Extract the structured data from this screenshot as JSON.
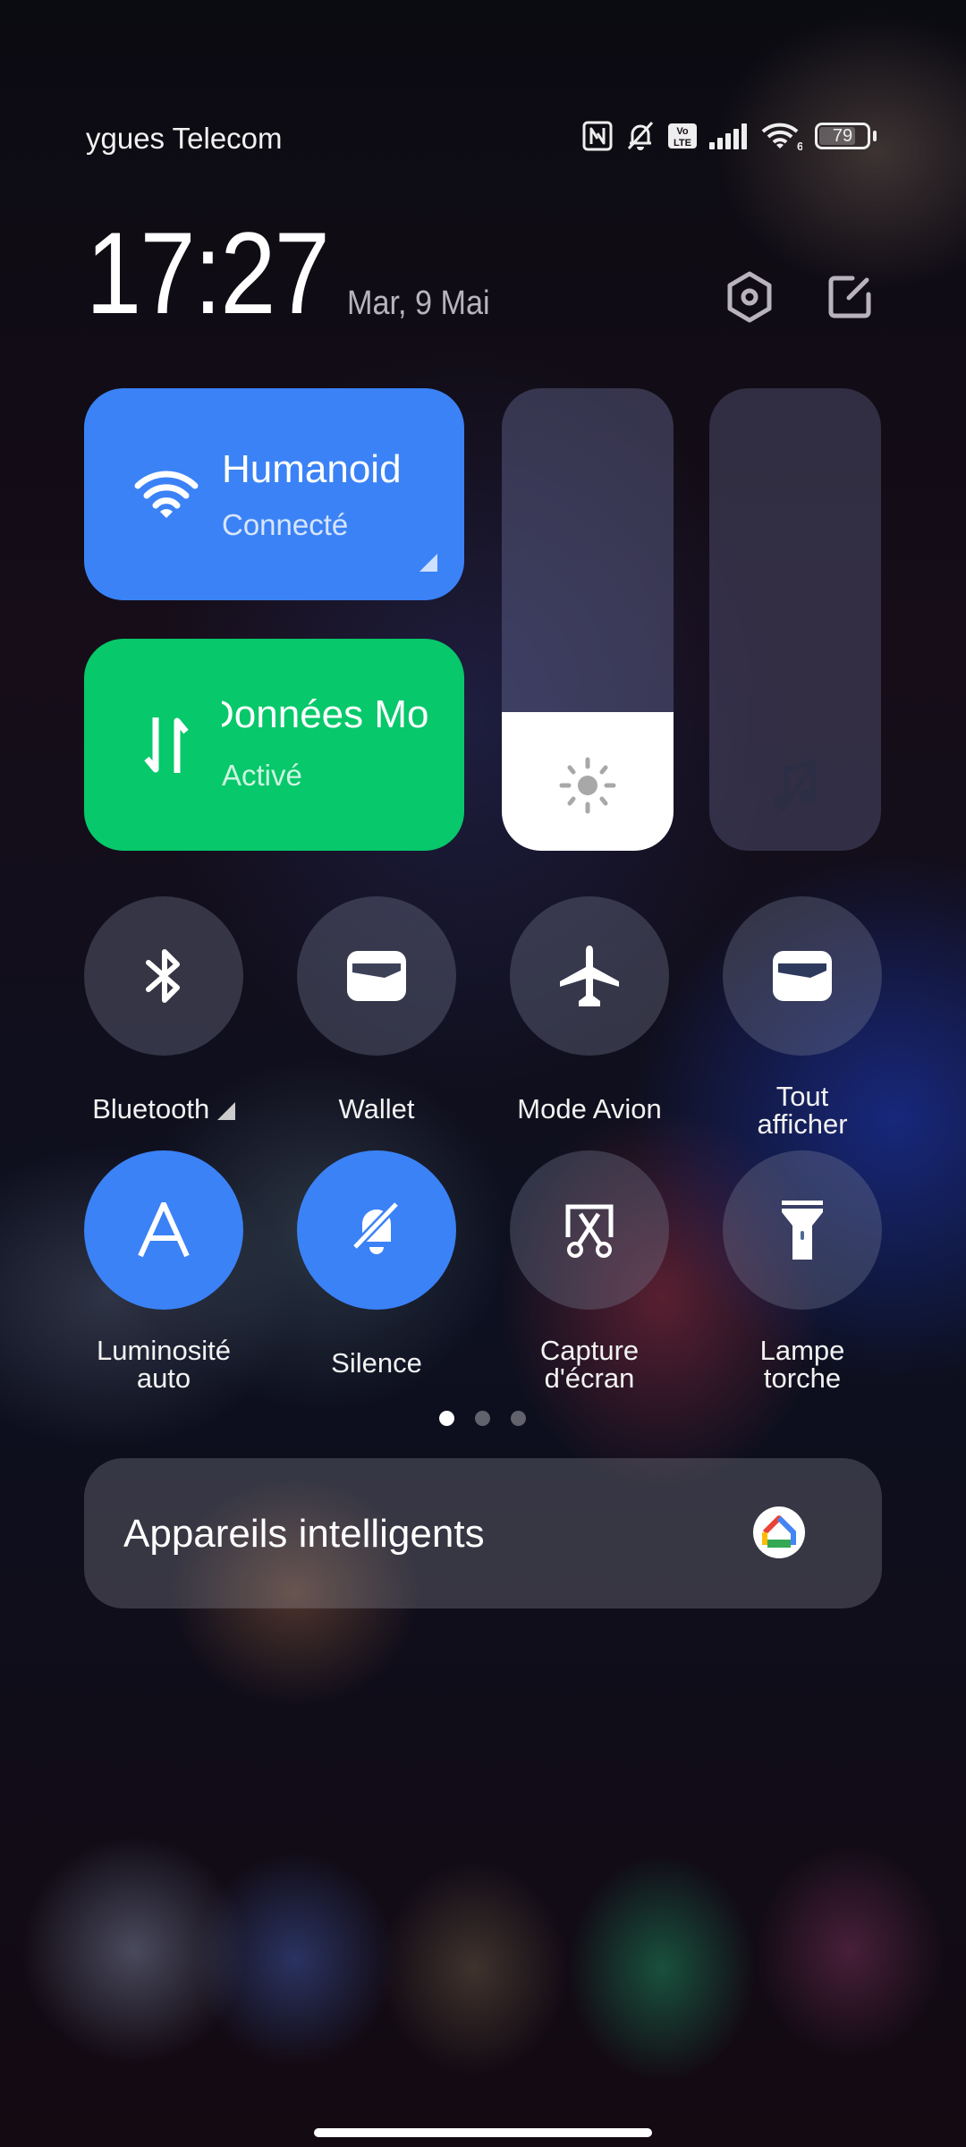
{
  "status_bar": {
    "carrier": "ygues Telecom",
    "icons": [
      "nfc-icon",
      "bell-off-icon",
      "volte-icon",
      "signal-icon",
      "wifi-6-icon",
      "battery-icon"
    ],
    "volte_top": "Vo",
    "volte_bottom": "LTE",
    "wifi_generation": "6",
    "battery_level": "79",
    "battery_percent": 79
  },
  "header": {
    "time": "17:27",
    "date": "Mar, 9 Mai",
    "settings_icon": "settings-icon",
    "edit_icon": "edit-icon"
  },
  "tiles": {
    "wifi": {
      "title": "Humanoid",
      "subtitle": "Connecté",
      "color": "#3b82f6",
      "active": true
    },
    "mobile_data": {
      "title": "Données Mobiles",
      "title_visible": "Données Mo",
      "subtitle": "Activé",
      "color": "#07c86a",
      "active": true
    }
  },
  "sliders": {
    "brightness": {
      "level_percent": 30,
      "icon": "sun-icon"
    },
    "volume": {
      "level_percent": 0,
      "icon": "music-off-icon"
    }
  },
  "toggles": [
    {
      "label": "Bluetooth",
      "active": false,
      "icon": "bluetooth-icon",
      "has_expand": true
    },
    {
      "label": "Wallet",
      "active": false,
      "icon": "wallet-icon"
    },
    {
      "label": "Mode Avion",
      "active": false,
      "icon": "airplane-icon"
    },
    {
      "label_line1": "Tout",
      "label_line2": "afficher",
      "active": false,
      "icon": "wallet-icon"
    },
    {
      "label_line1": "Luminosité",
      "label_line2": "auto",
      "active": true,
      "icon": "auto-brightness-icon"
    },
    {
      "label": "Silence",
      "active": true,
      "icon": "bell-off-icon"
    },
    {
      "label_line1": "Capture",
      "label_line2": "d'écran",
      "active": false,
      "icon": "screenshot-icon"
    },
    {
      "label_line1": "Lampe",
      "label_line2": "torche",
      "active": false,
      "icon": "flashlight-icon"
    }
  ],
  "pagination": {
    "pages": 3,
    "current": 1
  },
  "smart_devices": {
    "label": "Appareils intelligents",
    "icon": "google-home-icon"
  },
  "colors": {
    "accent_blue": "#3b82f6",
    "accent_green": "#07c86a"
  }
}
